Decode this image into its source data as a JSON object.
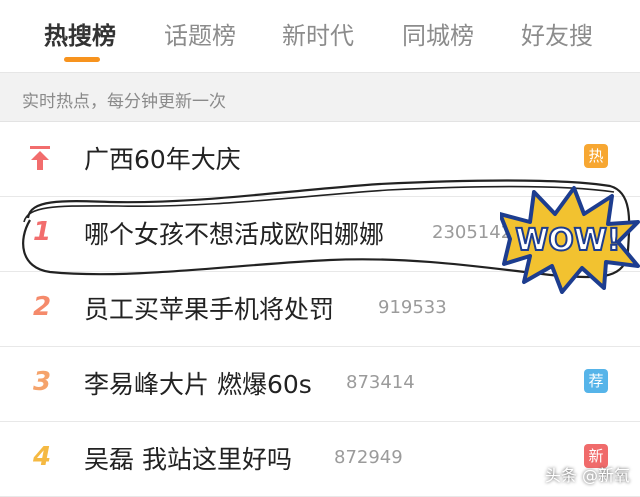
{
  "tabs": [
    "热搜榜",
    "话题榜",
    "新时代",
    "同城榜",
    "好友搜"
  ],
  "subheader": "实时热点，每分钟更新一次",
  "rows": [
    {
      "rank": "",
      "title": "广西60年大庆",
      "count": "",
      "badge": "热"
    },
    {
      "rank": "1",
      "title": "哪个女孩不想活成欧阳娜娜",
      "count": "2305142",
      "badge": ""
    },
    {
      "rank": "2",
      "title": "员工买苹果手机将处罚",
      "count": "919533",
      "badge": ""
    },
    {
      "rank": "3",
      "title": "李易峰大片 燃爆60s",
      "count": "873414",
      "badge": "荐"
    },
    {
      "rank": "4",
      "title": "吴磊 我站这里好吗",
      "count": "872949",
      "badge": "新"
    }
  ],
  "sticker": "WOW!",
  "watermark": "头条 @新氧",
  "colors": {
    "accent": "#f7931e",
    "hot_badge": "#f7a732",
    "rec_badge": "#56b4e9",
    "new_badge": "#f06b6b"
  }
}
